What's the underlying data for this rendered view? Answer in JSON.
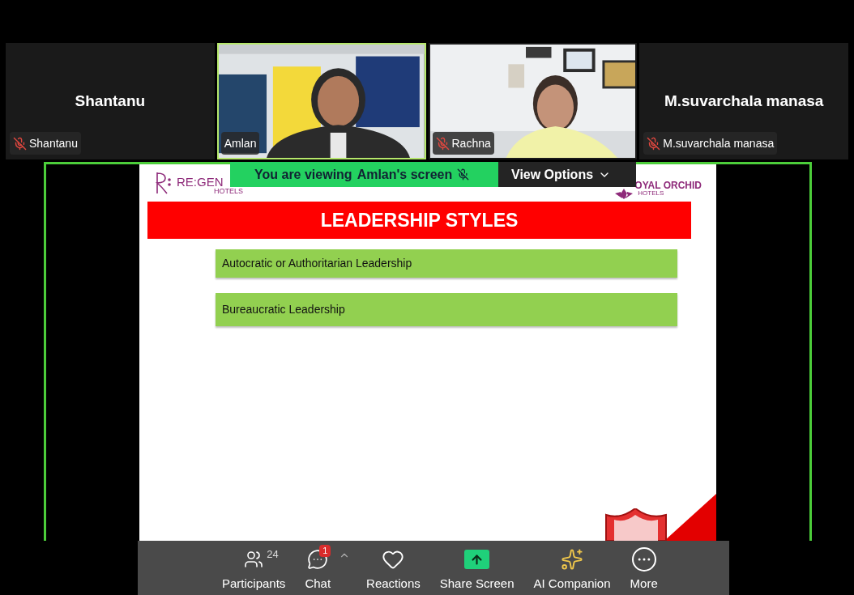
{
  "tiles": [
    {
      "kind": "avatar",
      "display_name": "Shantanu",
      "label": "Shantanu",
      "muted": true,
      "speaking": false
    },
    {
      "kind": "video",
      "label": "Amlan",
      "muted": false,
      "speaking": true
    },
    {
      "kind": "video",
      "label": "Rachna",
      "muted": true,
      "speaking": false
    },
    {
      "kind": "avatar",
      "display_name": "M.suvarchala manasa",
      "label": "M.suvarchala manasa",
      "muted": true,
      "speaking": false
    }
  ],
  "share": {
    "banner": {
      "text": "You are viewing",
      "owner": "Amlan's screen",
      "muted": true,
      "options": "View Options"
    },
    "slide": {
      "brand_left": "RE:GEN",
      "brand_left_sub": "HOTELS",
      "brand_right": "OYAL ORCHID",
      "brand_right_sub": "HOTELS",
      "title": "LEADERSHIP STYLES",
      "items": [
        "Autocratic or Authoritarian Leadership",
        "Bureaucratic Leadership"
      ]
    }
  },
  "toolbar": [
    {
      "kind": "participants",
      "label": "Participants",
      "count": "24"
    },
    {
      "kind": "chat",
      "label": "Chat",
      "badge": "1",
      "menu": true
    },
    {
      "kind": "reactions",
      "label": "Reactions"
    },
    {
      "kind": "share",
      "label": "Share Screen"
    },
    {
      "kind": "ai",
      "label": "AI Companion"
    },
    {
      "kind": "more",
      "label": "More"
    }
  ]
}
